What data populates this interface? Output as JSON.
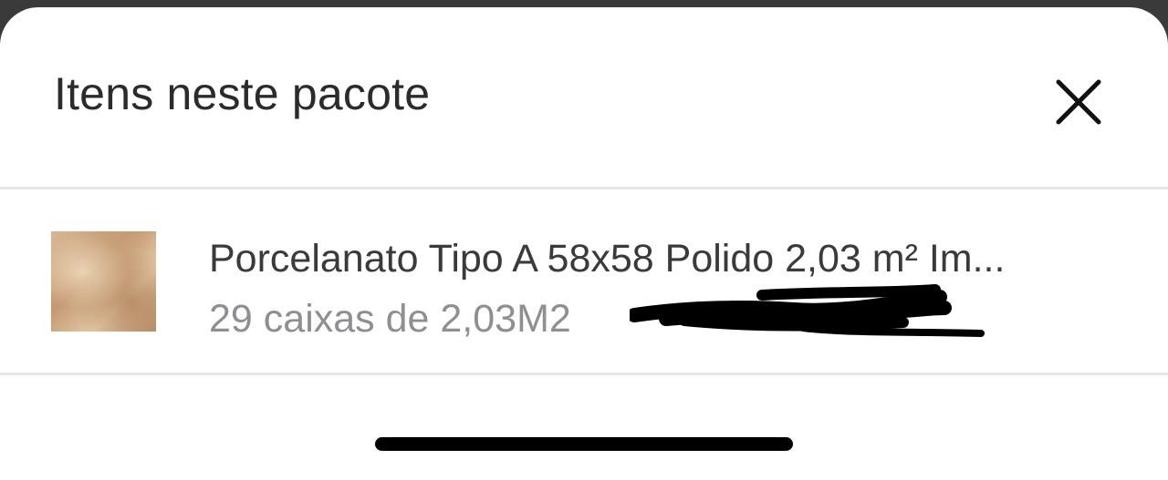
{
  "sheet": {
    "title": "Itens neste pacote",
    "close_icon": "close-icon"
  },
  "items": [
    {
      "name": "Porcelanato Tipo A 58x58 Polido 2,03 m² Im...",
      "detail": "29 caixas de 2,03M2"
    }
  ],
  "colors": {
    "title": "#2b2b2b",
    "name": "#3a3a3c",
    "detail": "#8e8e93",
    "divider": "#e6e6e6"
  }
}
